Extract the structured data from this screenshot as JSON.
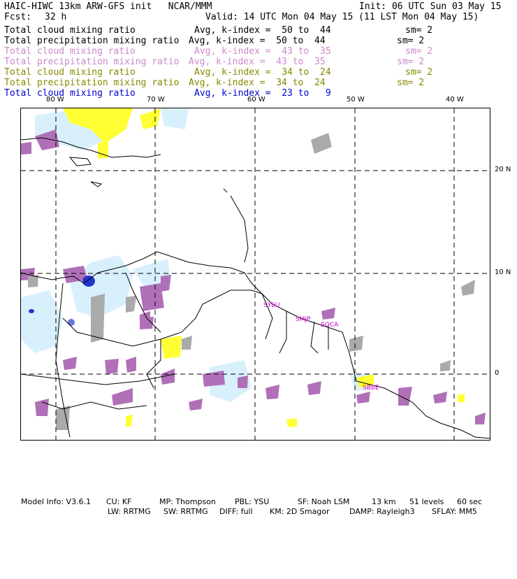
{
  "header": {
    "model_title": "HAIC-HIWC 13km ARW-GFS init   NCAR/MMM",
    "init": "Init: 06 UTC Sun 03 May 15",
    "fcst_label": "Fcst:",
    "fcst_value": "32 h",
    "valid": "Valid: 14 UTC Mon 04 May 15 (11 LST Mon 04 May 15)"
  },
  "legend": [
    {
      "field": "Total cloud mixing ratio",
      "range": "Avg, k-index =  50 to  44",
      "sm": "sm= 2",
      "color": "#000000",
      "offset": 0
    },
    {
      "field": "Total precipitation mixing ratio",
      "range": "Avg, k-index =  50 to  44",
      "sm": "sm= 2",
      "color": "#000000",
      "offset": -8
    },
    {
      "field": "Total cloud mixing ratio",
      "range": "Avg, k-index =  43 to  35",
      "sm": "sm= 2",
      "color": "#cc88cc",
      "offset": 0
    },
    {
      "field": "Total precipitation mixing ratio",
      "range": "Avg, k-index =  43 to  35",
      "sm": "sm= 2",
      "color": "#cc88cc",
      "offset": -8
    },
    {
      "field": "Total cloud mixing ratio",
      "range": "Avg, k-index =  34 to  24",
      "sm": "sm= 2",
      "color": "#888800",
      "offset": 0
    },
    {
      "field": "Total precipitation mixing ratio",
      "range": "Avg, k-index =  34 to  24",
      "sm": "sm= 2",
      "color": "#888800",
      "offset": -8
    },
    {
      "field": "Total cloud mixing ratio",
      "range": "Avg, k-index =  23 to   9",
      "sm": "",
      "color": "#0000cc",
      "offset": 0
    }
  ],
  "axes": {
    "lon_labels": [
      "80 W",
      "70 W",
      "60 W",
      "50 W",
      "40 W"
    ],
    "lat_labels": [
      "20 N",
      "10 N",
      "0"
    ]
  },
  "stations": [
    "SYEU",
    "SMJP",
    "SOCA",
    "SBBE"
  ],
  "footer": {
    "line1": [
      "Model Info: V3.6.1",
      "CU: KF",
      "MP: Thompson",
      "PBL: YSU",
      "SF: Noah LSM",
      "13 km",
      "51 levels",
      "60 sec"
    ],
    "line2": [
      "LW: RRTMG",
      "SW: RRTMG",
      "DIFF: full",
      "KM: 2D Smagor",
      "DAMP: Rayleigh3",
      "SFLAY: MM5"
    ]
  },
  "colors": {
    "yellow": "#ffff33",
    "light_blue": "#d8f0fc",
    "purple": "#b070b8",
    "gray": "#aaaaaa",
    "blue": "#2233cc",
    "station_magenta": "#cc00cc"
  }
}
